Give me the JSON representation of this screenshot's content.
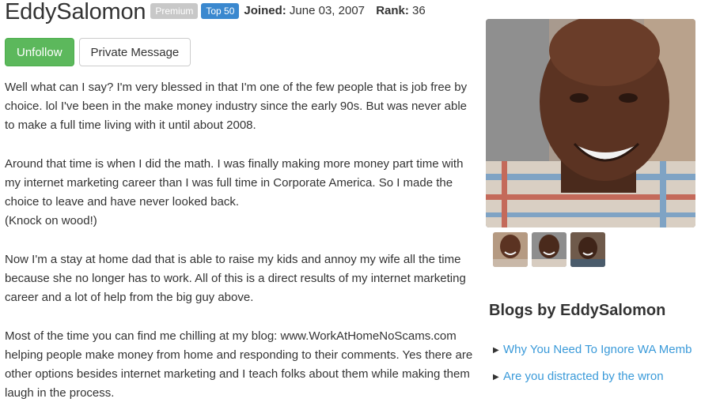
{
  "profile": {
    "username": "EddySalomon",
    "badges": {
      "premium": "Premium",
      "top": "Top 50"
    },
    "joined_label": "Joined:",
    "joined_value": "June 03, 2007",
    "rank_label": "Rank:",
    "rank_value": "36"
  },
  "actions": {
    "unfollow": "Unfollow",
    "private_message": "Private Message"
  },
  "bio": {
    "p1": "Well what can I say? I'm very blessed in that I'm one of the few people that is job free by choice. lol I've been in the make money industry since the early 90s. But was never able to make a full time living with it until about 2008.",
    "p2": "Around that time is when I did the math. I was finally making more money part time with my internet marketing career than I was full time in Corporate America. So I made the choice to leave and have never looked back.\n(Knock on wood!)",
    "p3": "Now I'm a stay at home dad that is able to raise my kids and annoy my wife all the time because she no longer has to work. All of this is a direct results of my internet marketing career and a lot of help from the big guy above.",
    "p4": "Most of the time you can find me chilling at my blog: www.WorkAtHomeNoScams.com helping people make money from home and responding to their comments. Yes there are other options besides internet marketing and I teach folks about them while making them laugh in the process."
  },
  "sidebar": {
    "blogs_title": "Blogs by EddySalomon",
    "blogs": [
      {
        "title": "Why You Need To Ignore WA Memb"
      },
      {
        "title": "Are you distracted by the wron"
      }
    ]
  },
  "colors": {
    "primary_green": "#5cb85c",
    "badge_blue": "#3a88cf",
    "badge_gray": "#c8c8c8",
    "link_blue": "#3a9ad9"
  },
  "icons": {
    "list_bullet": "caret-right-icon"
  }
}
